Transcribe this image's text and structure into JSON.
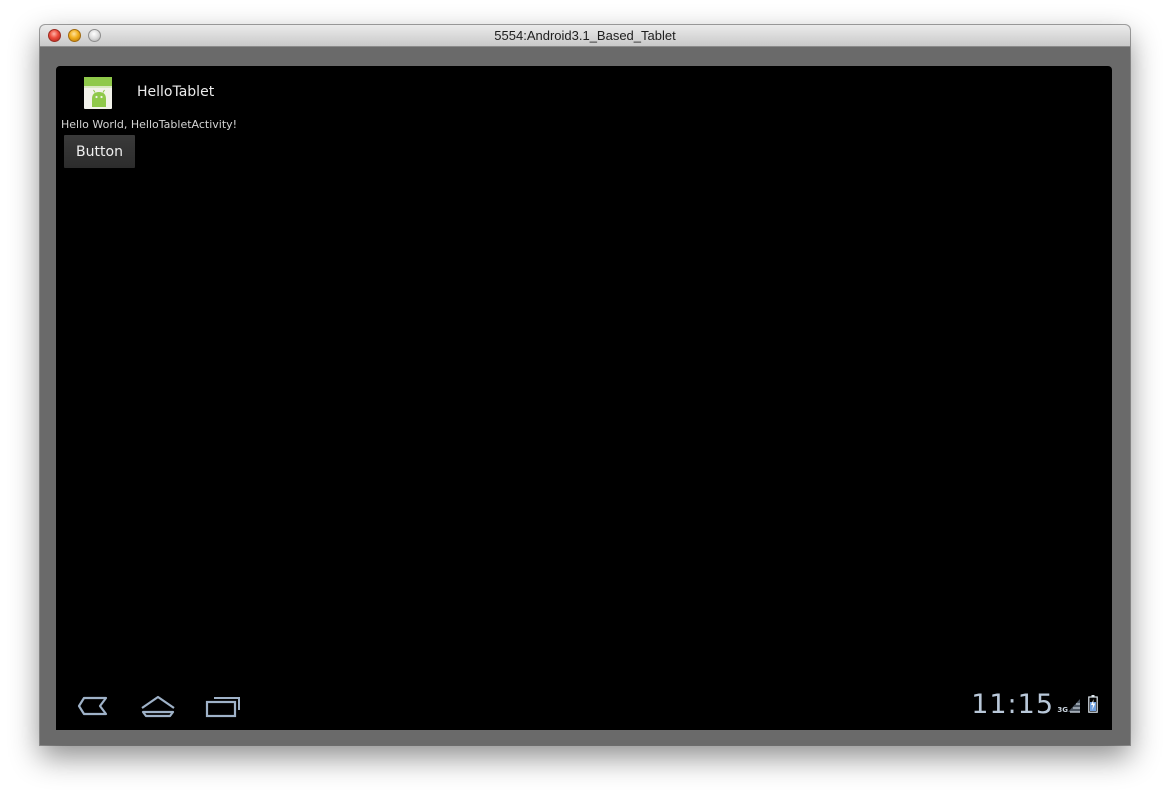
{
  "window": {
    "title": "5554:Android3.1_Based_Tablet"
  },
  "app": {
    "title": "HelloTablet",
    "icon": "android-app-icon"
  },
  "content": {
    "hello_text": "Hello World, HelloTabletActivity!",
    "button_label": "Button"
  },
  "system_bar": {
    "nav_icons": [
      "back-icon",
      "home-icon",
      "recent-apps-icon"
    ],
    "clock": "11:15",
    "network_type": "3G",
    "status_icons": [
      "signal-icon",
      "battery-icon"
    ]
  },
  "colors": {
    "screen_background": "#000000",
    "status_accent": "#b9c8d9"
  }
}
